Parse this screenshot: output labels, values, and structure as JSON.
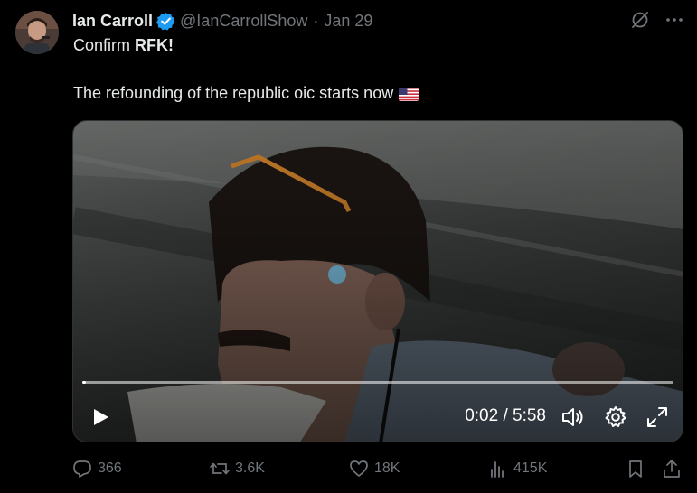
{
  "tweet": {
    "author_name": "Ian Carroll",
    "handle": "@IanCarrollShow",
    "separator": "·",
    "date": "Jan 29",
    "text_line1_prefix": "Confirm ",
    "text_line1_bold": "RFK!",
    "text_line2": "The refounding of the republic oic starts now",
    "flag_emoji": "us-flag"
  },
  "video": {
    "time_display": "0:02 / 5:58",
    "progress": 0.006
  },
  "actions": {
    "replies": "366",
    "reposts": "3.6K",
    "likes": "18K",
    "views": "415K"
  },
  "colors": {
    "background": "#000000",
    "text": "#e7e9ea",
    "muted": "#71767b",
    "verified": "#1d9bf0"
  }
}
